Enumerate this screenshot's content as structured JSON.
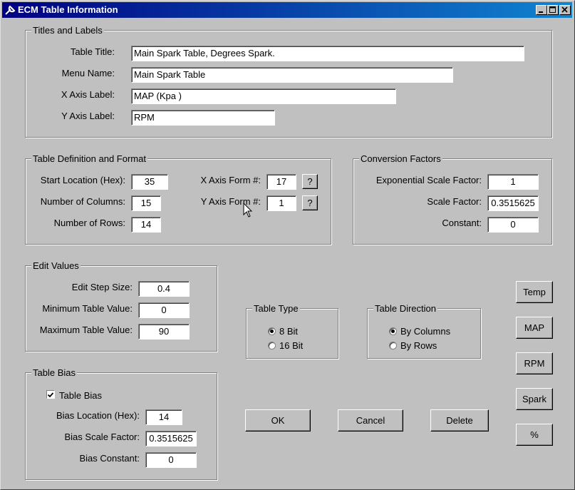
{
  "window": {
    "title": "ECM Table Information",
    "icon": "wrench-icon"
  },
  "titles_labels": {
    "legend": "Titles and Labels",
    "table_title": {
      "label": "Table Title:",
      "value": "Main Spark Table, Degrees Spark."
    },
    "menu_name": {
      "label": "Menu Name:",
      "value": "Main Spark Table"
    },
    "x_axis_label": {
      "label": "X Axis Label:",
      "value": "MAP (Kpa )"
    },
    "y_axis_label": {
      "label": "Y Axis Label:",
      "value": "RPM"
    }
  },
  "table_def": {
    "legend": "Table Definition and Format",
    "start_location": {
      "label": "Start Location (Hex):",
      "value": "35"
    },
    "num_columns": {
      "label": "Number of Columns:",
      "value": "15"
    },
    "num_rows": {
      "label": "Number of Rows:",
      "value": "14"
    },
    "x_axis_form": {
      "label": "X Axis Form #:",
      "value": "17"
    },
    "y_axis_form": {
      "label": "Y Axis Form #:",
      "value": "1"
    },
    "help_label": "?"
  },
  "conversion": {
    "legend": "Conversion Factors",
    "exp_scale": {
      "label": "Exponential Scale Factor:",
      "value": "1"
    },
    "scale": {
      "label": "Scale Factor:",
      "value": "0.3515625"
    },
    "constant": {
      "label": "Constant:",
      "value": "0"
    }
  },
  "edit_values": {
    "legend": "Edit Values",
    "step": {
      "label": "Edit Step Size:",
      "value": "0.4"
    },
    "min": {
      "label": "Minimum Table Value:",
      "value": "0"
    },
    "max": {
      "label": "Maximum Table Value:",
      "value": "90"
    }
  },
  "table_type": {
    "legend": "Table Type",
    "options": [
      "8 Bit",
      "16 Bit"
    ],
    "selected": "8 Bit"
  },
  "table_direction": {
    "legend": "Table Direction",
    "options": [
      "By Columns",
      "By Rows"
    ],
    "selected": "By Columns"
  },
  "table_bias": {
    "legend": "Table Bias",
    "checkbox_label": "Table Bias",
    "checked": true,
    "location": {
      "label": "Bias Location (Hex):",
      "value": "14"
    },
    "scale": {
      "label": "Bias Scale Factor:",
      "value": "0.3515625"
    },
    "constant": {
      "label": "Bias Constant:",
      "value": "0"
    }
  },
  "side_buttons": [
    "Temp",
    "MAP",
    "RPM",
    "Spark",
    "%"
  ],
  "actions": {
    "ok": "OK",
    "cancel": "Cancel",
    "delete": "Delete"
  }
}
